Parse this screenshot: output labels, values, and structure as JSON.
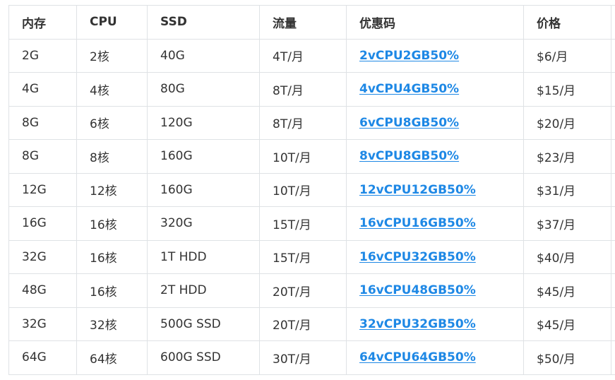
{
  "table": {
    "headers": [
      "内存",
      "CPU",
      "SSD",
      "流量",
      "优惠码",
      "价格"
    ],
    "rows": [
      {
        "mem": "2G",
        "cpu": "2核",
        "ssd": "40G",
        "traffic": "4T/月",
        "code": "2vCPU2GB50%",
        "price": "$6/月"
      },
      {
        "mem": "4G",
        "cpu": "4核",
        "ssd": "80G",
        "traffic": "8T/月",
        "code": "4vCPU4GB50%",
        "price": "$15/月"
      },
      {
        "mem": "8G",
        "cpu": "6核",
        "ssd": "120G",
        "traffic": "8T/月",
        "code": "6vCPU8GB50%",
        "price": "$20/月"
      },
      {
        "mem": "8G",
        "cpu": "8核",
        "ssd": "160G",
        "traffic": "10T/月",
        "code": "8vCPU8GB50%",
        "price": "$23/月"
      },
      {
        "mem": "12G",
        "cpu": "12核",
        "ssd": "160G",
        "traffic": "10T/月",
        "code": "12vCPU12GB50%",
        "price": "$31/月"
      },
      {
        "mem": "16G",
        "cpu": "16核",
        "ssd": "320G",
        "traffic": "15T/月",
        "code": "16vCPU16GB50%",
        "price": "$37/月"
      },
      {
        "mem": "32G",
        "cpu": "16核",
        "ssd": "1T HDD",
        "traffic": "15T/月",
        "code": "16vCPU32GB50%",
        "price": "$40/月"
      },
      {
        "mem": "48G",
        "cpu": "16核",
        "ssd": "2T HDD",
        "traffic": "20T/月",
        "code": "16vCPU48GB50%",
        "price": "$45/月"
      },
      {
        "mem": "32G",
        "cpu": "32核",
        "ssd": "500G SSD",
        "traffic": "20T/月",
        "code": "32vCPU32GB50%",
        "price": "$45/月"
      },
      {
        "mem": "64G",
        "cpu": "64核",
        "ssd": "600G SSD",
        "traffic": "30T/月",
        "code": "64vCPU64GB50%",
        "price": "$50/月"
      }
    ]
  }
}
